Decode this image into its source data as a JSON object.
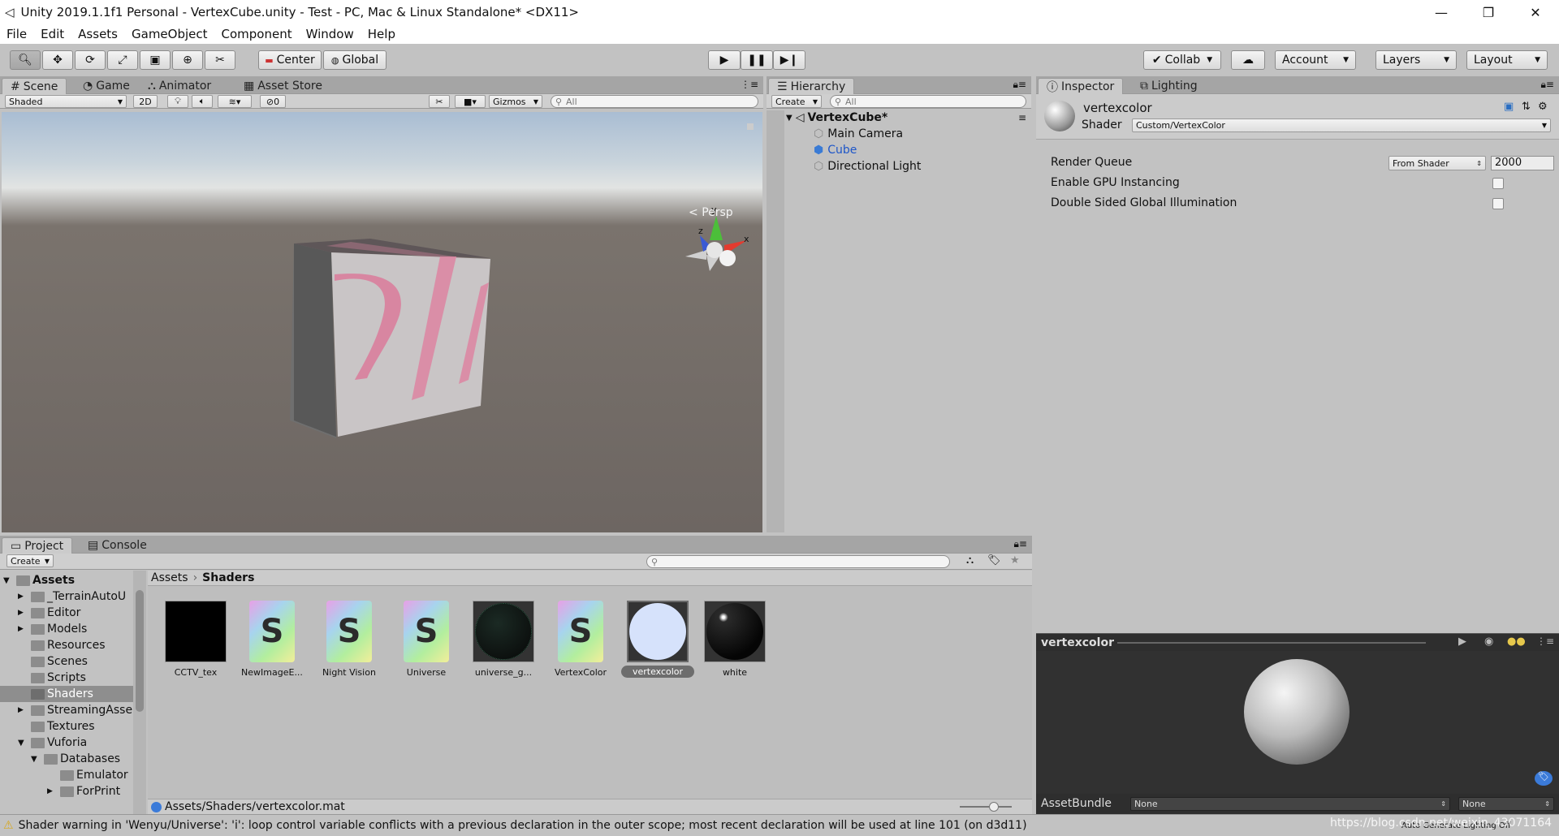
{
  "window": {
    "title": "Unity 2019.1.1f1 Personal - VertexCube.unity - Test - PC, Mac & Linux Standalone* <DX11>",
    "minimize": "—",
    "restore": "❐",
    "close": "✕"
  },
  "menu": [
    "File",
    "Edit",
    "Assets",
    "GameObject",
    "Component",
    "Window",
    "Help"
  ],
  "toolbar": {
    "pivot": "Center",
    "space": "Global",
    "collab": "Collab",
    "account": "Account",
    "layers": "Layers",
    "layout": "Layout"
  },
  "scene": {
    "tabs": [
      "Scene",
      "Game",
      "Animator",
      "Asset Store"
    ],
    "shading": "Shaded",
    "mode2d": "2D",
    "hidden_count": "0",
    "gizmos": "Gizmos",
    "search_placeholder": "All",
    "persp_label": "Persp",
    "axis_y": "y",
    "axis_x": "x",
    "axis_z": "z"
  },
  "hierarchy": {
    "tab": "Hierarchy",
    "create": "Create",
    "search_placeholder": "All",
    "scene_name": "VertexCube*",
    "items": [
      "Main Camera",
      "Cube",
      "Directional Light"
    ],
    "selected_color": "#1e56c8"
  },
  "inspector": {
    "tabs": [
      "Inspector",
      "Lighting"
    ],
    "material_name": "vertexcolor",
    "shader_label": "Shader",
    "shader_value": "Custom/VertexColor",
    "render_queue_label": "Render Queue",
    "render_queue_mode": "From Shader",
    "render_queue_value": "2000",
    "gpu_instancing_label": "Enable GPU Instancing",
    "double_sided_gi_label": "Double Sided Global Illumination",
    "preview_title": "vertexcolor",
    "assetbundle_label": "AssetBundle",
    "assetbundle_name": "None",
    "assetbundle_variant": "None"
  },
  "project": {
    "tabs": [
      "Project",
      "Console"
    ],
    "create": "Create",
    "tree": [
      {
        "label": "Assets",
        "depth": 0,
        "arrow": "▼",
        "bold": true
      },
      {
        "label": "_TerrainAutoU",
        "depth": 1,
        "arrow": "▶"
      },
      {
        "label": "Editor",
        "depth": 1,
        "arrow": "▶"
      },
      {
        "label": "Models",
        "depth": 1,
        "arrow": "▶"
      },
      {
        "label": "Resources",
        "depth": 1,
        "arrow": ""
      },
      {
        "label": "Scenes",
        "depth": 1,
        "arrow": ""
      },
      {
        "label": "Scripts",
        "depth": 1,
        "arrow": ""
      },
      {
        "label": "Shaders",
        "depth": 1,
        "arrow": "",
        "selected": true
      },
      {
        "label": "StreamingAsse",
        "depth": 1,
        "arrow": "▶"
      },
      {
        "label": "Textures",
        "depth": 1,
        "arrow": ""
      },
      {
        "label": "Vuforia",
        "depth": 1,
        "arrow": "▼"
      },
      {
        "label": "Databases",
        "depth": 2,
        "arrow": "▼"
      },
      {
        "label": "Emulator",
        "depth": 3,
        "arrow": ""
      },
      {
        "label": "ForPrint",
        "depth": 3,
        "arrow": "▶"
      }
    ],
    "breadcrumb_root": "Assets",
    "breadcrumb_sep": "›",
    "breadcrumb_current": "Shaders",
    "assets": [
      {
        "name": "CCTV_tex",
        "kind": "black"
      },
      {
        "name": "NewImageE...",
        "kind": "shader"
      },
      {
        "name": "Night Vision",
        "kind": "shader"
      },
      {
        "name": "Universe",
        "kind": "shader"
      },
      {
        "name": "universe_g...",
        "kind": "sphere-dark-grid"
      },
      {
        "name": "VertexColor",
        "kind": "shader"
      },
      {
        "name": "vertexcolor",
        "kind": "sphere-white",
        "selected": true
      },
      {
        "name": "white",
        "kind": "sphere-black"
      }
    ],
    "shader_glyph": "S",
    "selected_path": "Assets/Shaders/vertexcolor.mat"
  },
  "status": {
    "warning": "Shader warning in 'Wenyu/Universe': 'i': loop control variable conflicts with a previous declaration in the outer scope; most recent declaration will be used at line 101 (on d3d11)",
    "lighting": "Auto Generate Lighting Off",
    "watermark": "https://blog.csdn.net/weixin_43071164"
  }
}
